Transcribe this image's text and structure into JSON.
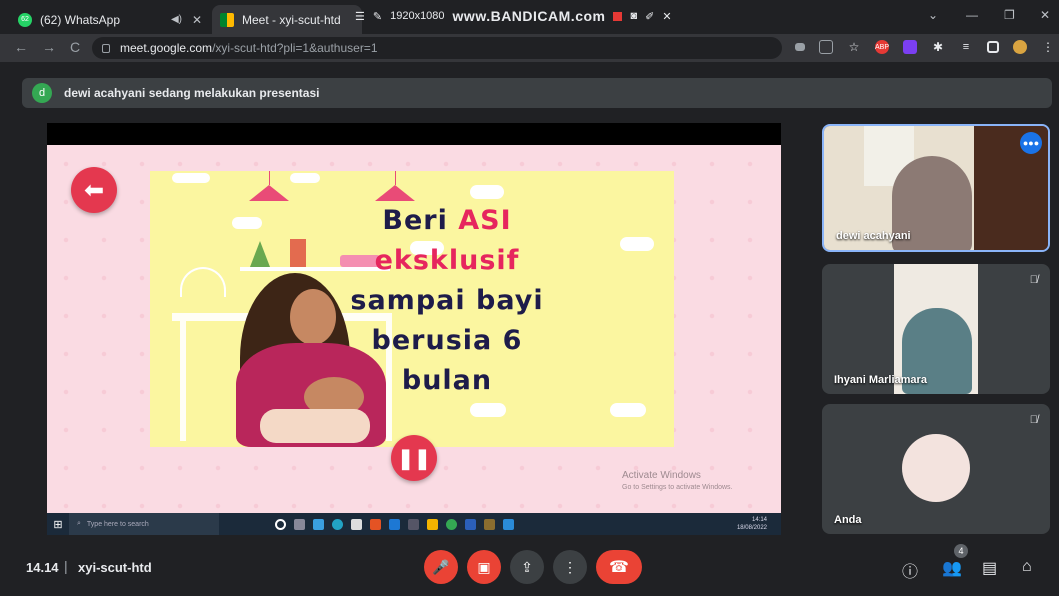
{
  "tabs": [
    {
      "title": "(62) WhatsApp",
      "badge": "62"
    },
    {
      "title": "Meet - xyi-scut-htd"
    }
  ],
  "bandicam": {
    "resolution": "1920x1080",
    "logo": "www.BANDICAM.com"
  },
  "address": {
    "host": "meet.google.com",
    "path": "/xyi-scut-htd?pli=1&authuser=1"
  },
  "banner": {
    "avatar": "d",
    "text": "dewi acahyani sedang melakukan presentasi"
  },
  "slide": {
    "line1a": "Beri ",
    "line1b": "ASI",
    "line2": "eksklusif",
    "line3": "sampai bayi",
    "line4": "berusia 6 bulan"
  },
  "watermark": {
    "title": "Activate Windows",
    "sub": "Go to Settings to activate Windows."
  },
  "taskbar": {
    "search": "Type here to search",
    "time": "14:14",
    "date": "18/08/2022"
  },
  "participants": [
    {
      "name": "dewi acahyani",
      "speaking": true
    },
    {
      "name": "Ihyani Marliamara",
      "muted": true
    },
    {
      "name": "Anda",
      "muted": true
    }
  ],
  "meeting": {
    "time": "14.14",
    "code": "xyi-scut-htd",
    "people_count": "4"
  },
  "colors": {
    "end_call": "#ea4335",
    "accent": "#8ab4f8",
    "slide_bg": "#fadbe3",
    "card_bg": "#fbf6a0"
  }
}
